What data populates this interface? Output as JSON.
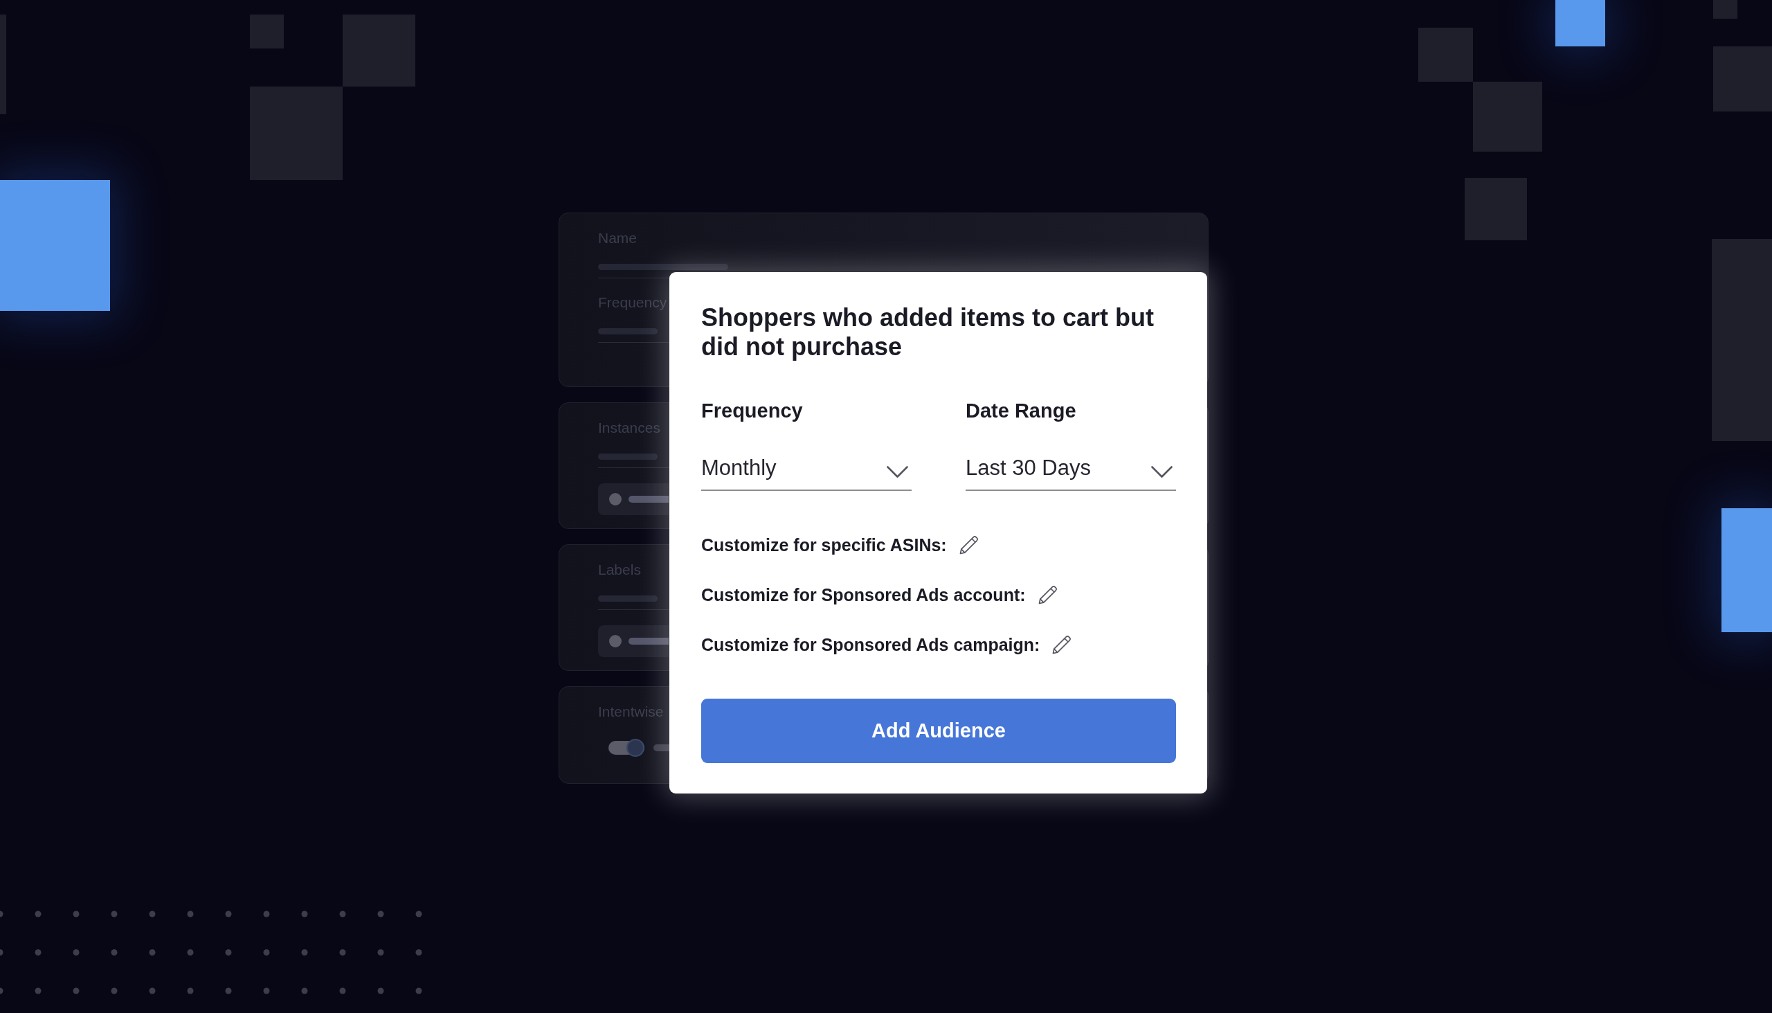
{
  "background_cards": [
    {
      "kind": "fields",
      "labels": [
        "Name",
        "Frequency"
      ]
    },
    {
      "kind": "chip",
      "labels": [
        "Instances"
      ]
    },
    {
      "kind": "chip",
      "labels": [
        "Labels"
      ]
    },
    {
      "kind": "toggle",
      "labels": [
        "Intentwise"
      ],
      "on": true
    }
  ],
  "dialog": {
    "title": "Shoppers who added items to cart but did not purchase",
    "dropdowns": [
      {
        "label": "Frequency",
        "value": "Monthly"
      },
      {
        "label": "Date Range",
        "value": "Last 30 Days"
      }
    ],
    "customize_options": [
      "Customize for specific ASINs:",
      "Customize for Sponsored Ads account:",
      "Customize for Sponsored Ads campaign:"
    ],
    "primary_button": "Add Audience"
  }
}
